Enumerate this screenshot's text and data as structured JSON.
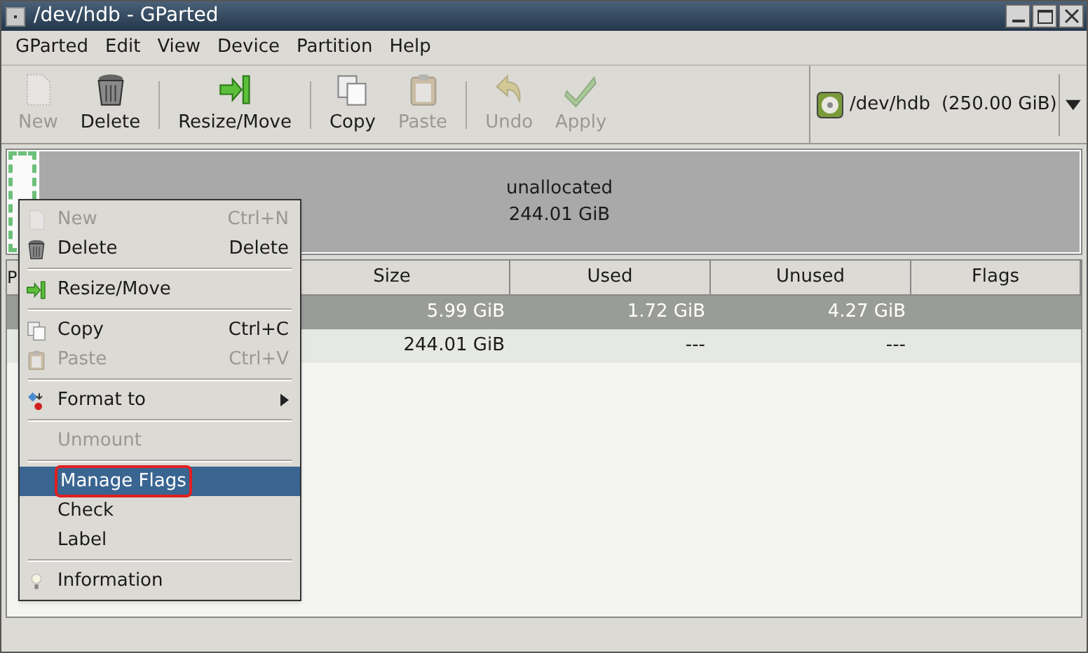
{
  "window": {
    "title": "/dev/hdb - GParted"
  },
  "menu_bar": [
    "GParted",
    "Edit",
    "View",
    "Device",
    "Partition",
    "Help"
  ],
  "toolbar": [
    {
      "kind": "new",
      "label": "New",
      "disabled": true
    },
    {
      "kind": "delete",
      "label": "Delete",
      "disabled": false
    },
    {
      "kind": "separator"
    },
    {
      "kind": "resize",
      "label": "Resize/Move",
      "disabled": false
    },
    {
      "kind": "separator"
    },
    {
      "kind": "copy",
      "label": "Copy",
      "disabled": false
    },
    {
      "kind": "paste",
      "label": "Paste",
      "disabled": true
    },
    {
      "kind": "separator"
    },
    {
      "kind": "undo",
      "label": "Undo",
      "disabled": true
    },
    {
      "kind": "apply",
      "label": "Apply",
      "disabled": true
    }
  ],
  "device": {
    "name": "/dev/hdb",
    "size": "(250.00 GiB)"
  },
  "disk_map": [
    {
      "kind": "partition",
      "selected": true
    },
    {
      "kind": "unallocated",
      "label": "unallocated",
      "size": "244.01 GiB",
      "selected": false
    }
  ],
  "table": {
    "columns": [
      "P",
      "Size",
      "Used",
      "Unused",
      "Flags"
    ],
    "rows": [
      {
        "selected": true,
        "cells": [
          "",
          "5.99 GiB",
          "1.72 GiB",
          "4.27 GiB",
          ""
        ]
      },
      {
        "selected": false,
        "cells": [
          "",
          "244.01 GiB",
          "---",
          "---",
          ""
        ]
      }
    ]
  },
  "context_menu": [
    {
      "kind": "item",
      "label": "New",
      "shortcut": "Ctrl+N",
      "disabled": true,
      "selected": false
    },
    {
      "kind": "item",
      "label": "Delete",
      "shortcut": "Delete",
      "disabled": false,
      "selected": false
    },
    {
      "kind": "separator"
    },
    {
      "kind": "item",
      "label": "Resize/Move",
      "disabled": false,
      "selected": false
    },
    {
      "kind": "separator"
    },
    {
      "kind": "item",
      "label": "Copy",
      "shortcut": "Ctrl+C",
      "disabled": false,
      "selected": false
    },
    {
      "kind": "item",
      "label": "Paste",
      "shortcut": "Ctrl+V",
      "disabled": true,
      "selected": false
    },
    {
      "kind": "separator"
    },
    {
      "kind": "item",
      "label": "Format to",
      "submenu": true,
      "disabled": false,
      "selected": false
    },
    {
      "kind": "separator"
    },
    {
      "kind": "item",
      "label": "Unmount",
      "disabled": true,
      "selected": false
    },
    {
      "kind": "separator"
    },
    {
      "kind": "item",
      "label": "Manage Flags",
      "disabled": false,
      "selected": true,
      "annotated": true
    },
    {
      "kind": "item",
      "label": "Check",
      "disabled": false,
      "selected": false
    },
    {
      "kind": "item",
      "label": "Label",
      "disabled": false,
      "selected": false
    },
    {
      "kind": "separator"
    },
    {
      "kind": "item",
      "label": "Information",
      "disabled": false,
      "selected": false
    }
  ]
}
